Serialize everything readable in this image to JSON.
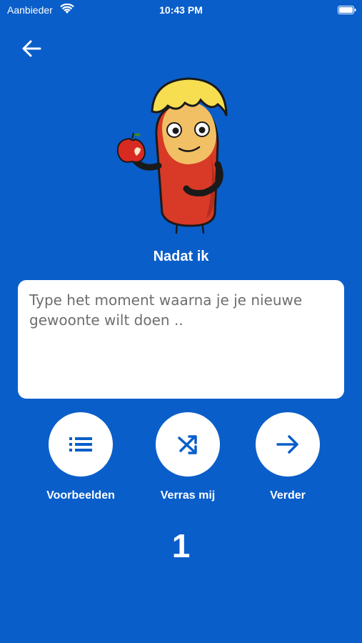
{
  "status_bar": {
    "carrier": "Aanbieder",
    "time": "10:43 PM",
    "icons": [
      "wifi-icon",
      "battery-icon"
    ]
  },
  "header": {
    "back_icon": "arrow-left-icon"
  },
  "illustration": {
    "name": "mascot-eating-apple"
  },
  "step": {
    "title": "Nadat ik",
    "input_placeholder": "Type het moment waarna je je nieuwe gewoonte wilt doen ..",
    "input_value": "",
    "number": "1"
  },
  "actions": [
    {
      "label": "Voorbeelden",
      "icon": "list-icon"
    },
    {
      "label": "Verras mij",
      "icon": "shuffle-icon"
    },
    {
      "label": "Verder",
      "icon": "arrow-right-icon"
    }
  ],
  "colors": {
    "background": "#0a5ec9",
    "icon_blue": "#0a5ec9",
    "card": "#ffffff",
    "text": "#ffffff"
  }
}
